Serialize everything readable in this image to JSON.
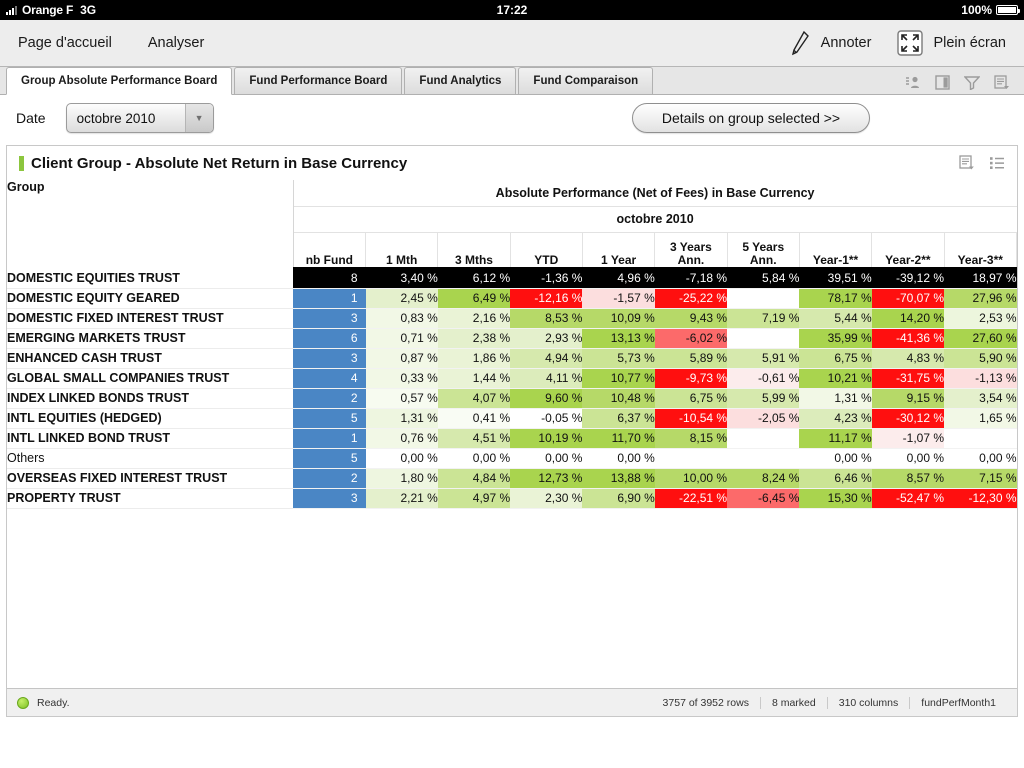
{
  "status_bar": {
    "carrier": "Orange F",
    "network": "3G",
    "time": "17:22",
    "battery_percent": "100%",
    "signal_icon": "signal-bars-icon",
    "battery_icon": "battery-icon"
  },
  "app_bar": {
    "nav_items": [
      {
        "label": "Page d'accueil",
        "name": "nav-item-home"
      },
      {
        "label": "Analyser",
        "name": "nav-item-analyse"
      }
    ],
    "annotate": {
      "label": "Annoter",
      "icon": "pencil-icon"
    },
    "fullscreen": {
      "label": "Plein écran",
      "icon": "fullscreen-icon"
    }
  },
  "tabs": {
    "items": [
      {
        "label": "Group Absolute Performance Board",
        "active": true
      },
      {
        "label": "Fund Performance Board",
        "active": false
      },
      {
        "label": "Fund Analytics",
        "active": false
      },
      {
        "label": "Fund Comparaison",
        "active": false
      }
    ],
    "icons": [
      "user-icon",
      "panel-icon",
      "filter-funnel-icon",
      "list-options-icon"
    ]
  },
  "filter_bar": {
    "date_label": "Date",
    "date_value": "octobre 2010",
    "date_caret_icon": "chevron-down-icon",
    "details_button": "Details on group selected >>"
  },
  "panel": {
    "title": "Client Group - Absolute Net Return in Base Currency",
    "accent_color": "#8cc63e",
    "icons": [
      "list-options-icon",
      "bullet-list-icon"
    ]
  },
  "table": {
    "group_header": "Group",
    "span_header": "Absolute Performance (Net of Fees) in Base Currency",
    "period_header": "octobre 2010",
    "columns": [
      "nb Fund",
      "1 Mth",
      "3 Mths",
      "YTD",
      "1 Year",
      "3 Years Ann.",
      "5 Years Ann.",
      "Year-1**",
      "Year-2**",
      "Year-3**"
    ],
    "rows": [
      {
        "label": "DOMESTIC EQUITIES TRUST",
        "bold": true,
        "selected": true,
        "cells": [
          {
            "v": "8",
            "bg": "#000000",
            "fg": "#ffffff"
          },
          {
            "v": "3,40 %",
            "bg": "#000000",
            "fg": "#ffffff"
          },
          {
            "v": "6,12 %",
            "bg": "#000000",
            "fg": "#ffffff"
          },
          {
            "v": "-1,36 %",
            "bg": "#000000",
            "fg": "#ffffff"
          },
          {
            "v": "4,96 %",
            "bg": "#000000",
            "fg": "#ffffff"
          },
          {
            "v": "-7,18 %",
            "bg": "#000000",
            "fg": "#ffffff"
          },
          {
            "v": "5,84 %",
            "bg": "#000000",
            "fg": "#ffffff"
          },
          {
            "v": "39,51 %",
            "bg": "#000000",
            "fg": "#ffffff"
          },
          {
            "v": "-39,12 %",
            "bg": "#000000",
            "fg": "#ffffff"
          },
          {
            "v": "18,97 %",
            "bg": "#000000",
            "fg": "#ffffff"
          }
        ]
      },
      {
        "label": "DOMESTIC EQUITY GEARED",
        "bold": true,
        "selected": false,
        "cells": [
          {
            "v": "1",
            "bg": "#4a86c5",
            "fg": "#ffffff"
          },
          {
            "v": "2,45 %",
            "bg": "#e4f0cc",
            "fg": "#111111"
          },
          {
            "v": "6,49 %",
            "bg": "#a9d44e",
            "fg": "#111111"
          },
          {
            "v": "-12,16 %",
            "bg": "#ff0f0f",
            "fg": "#ffffff"
          },
          {
            "v": "-1,57 %",
            "bg": "#fcdede",
            "fg": "#111111"
          },
          {
            "v": "-25,22 %",
            "bg": "#ff0f0f",
            "fg": "#ffffff"
          },
          {
            "v": "",
            "bg": "#ffffff",
            "fg": "#111111"
          },
          {
            "v": "78,17 %",
            "bg": "#a9d44e",
            "fg": "#111111"
          },
          {
            "v": "-70,07 %",
            "bg": "#ff0f0f",
            "fg": "#ffffff"
          },
          {
            "v": "27,96 %",
            "bg": "#b6d968",
            "fg": "#111111"
          }
        ]
      },
      {
        "label": "DOMESTIC FIXED INTEREST TRUST",
        "bold": true,
        "selected": false,
        "cells": [
          {
            "v": "3",
            "bg": "#4a86c5",
            "fg": "#ffffff"
          },
          {
            "v": "0,83 %",
            "bg": "#f2f8e6",
            "fg": "#111111"
          },
          {
            "v": "2,16 %",
            "bg": "#eaf3d6",
            "fg": "#111111"
          },
          {
            "v": "8,53 %",
            "bg": "#b6d968",
            "fg": "#111111"
          },
          {
            "v": "10,09 %",
            "bg": "#b6d968",
            "fg": "#111111"
          },
          {
            "v": "9,43 %",
            "bg": "#b6d968",
            "fg": "#111111"
          },
          {
            "v": "7,19 %",
            "bg": "#cbe495",
            "fg": "#111111"
          },
          {
            "v": "5,44 %",
            "bg": "#d6e9ad",
            "fg": "#111111"
          },
          {
            "v": "14,20 %",
            "bg": "#a9d44e",
            "fg": "#111111"
          },
          {
            "v": "2,53 %",
            "bg": "#edf6dd",
            "fg": "#111111"
          }
        ]
      },
      {
        "label": "EMERGING MARKETS TRUST",
        "bold": true,
        "selected": false,
        "cells": [
          {
            "v": "6",
            "bg": "#4a86c5",
            "fg": "#ffffff"
          },
          {
            "v": "0,71 %",
            "bg": "#f2f8e6",
            "fg": "#111111"
          },
          {
            "v": "2,38 %",
            "bg": "#e4f0cc",
            "fg": "#111111"
          },
          {
            "v": "2,93 %",
            "bg": "#e4f0cc",
            "fg": "#111111"
          },
          {
            "v": "13,13 %",
            "bg": "#a9d44e",
            "fg": "#111111"
          },
          {
            "v": "-6,02 %",
            "bg": "#fc6a6a",
            "fg": "#111111"
          },
          {
            "v": "",
            "bg": "#ffffff",
            "fg": "#111111"
          },
          {
            "v": "35,99 %",
            "bg": "#a9d44e",
            "fg": "#111111"
          },
          {
            "v": "-41,36 %",
            "bg": "#ff0f0f",
            "fg": "#ffffff"
          },
          {
            "v": "27,60 %",
            "bg": "#a9d44e",
            "fg": "#111111"
          }
        ]
      },
      {
        "label": "ENHANCED CASH TRUST",
        "bold": true,
        "selected": false,
        "cells": [
          {
            "v": "3",
            "bg": "#4a86c5",
            "fg": "#ffffff"
          },
          {
            "v": "0,87 %",
            "bg": "#f2f8e6",
            "fg": "#111111"
          },
          {
            "v": "1,86 %",
            "bg": "#eaf3d6",
            "fg": "#111111"
          },
          {
            "v": "4,94 %",
            "bg": "#d6e9ad",
            "fg": "#111111"
          },
          {
            "v": "5,73 %",
            "bg": "#cbe495",
            "fg": "#111111"
          },
          {
            "v": "5,89 %",
            "bg": "#cbe495",
            "fg": "#111111"
          },
          {
            "v": "5,91 %",
            "bg": "#d6e9ad",
            "fg": "#111111"
          },
          {
            "v": "6,75 %",
            "bg": "#cbe495",
            "fg": "#111111"
          },
          {
            "v": "4,83 %",
            "bg": "#d6e9ad",
            "fg": "#111111"
          },
          {
            "v": "5,90 %",
            "bg": "#cbe495",
            "fg": "#111111"
          }
        ]
      },
      {
        "label": "GLOBAL SMALL COMPANIES TRUST",
        "bold": true,
        "selected": false,
        "cells": [
          {
            "v": "4",
            "bg": "#4a86c5",
            "fg": "#ffffff"
          },
          {
            "v": "0,33 %",
            "bg": "#f2f8e6",
            "fg": "#111111"
          },
          {
            "v": "1,44 %",
            "bg": "#eaf3d6",
            "fg": "#111111"
          },
          {
            "v": "4,11 %",
            "bg": "#dcecbb",
            "fg": "#111111"
          },
          {
            "v": "10,77 %",
            "bg": "#a9d44e",
            "fg": "#111111"
          },
          {
            "v": "-9,73 %",
            "bg": "#ff0f0f",
            "fg": "#ffffff"
          },
          {
            "v": "-0,61 %",
            "bg": "#fcecec",
            "fg": "#111111"
          },
          {
            "v": "10,21 %",
            "bg": "#a9d44e",
            "fg": "#111111"
          },
          {
            "v": "-31,75 %",
            "bg": "#ff0f0f",
            "fg": "#ffffff"
          },
          {
            "v": "-1,13 %",
            "bg": "#fcdede",
            "fg": "#111111"
          }
        ]
      },
      {
        "label": "INDEX LINKED BONDS TRUST",
        "bold": true,
        "selected": false,
        "cells": [
          {
            "v": "2",
            "bg": "#4a86c5",
            "fg": "#ffffff"
          },
          {
            "v": "0,57 %",
            "bg": "#f7fbf0",
            "fg": "#111111"
          },
          {
            "v": "4,07 %",
            "bg": "#cbe495",
            "fg": "#111111"
          },
          {
            "v": "9,60 %",
            "bg": "#a9d44e",
            "fg": "#111111"
          },
          {
            "v": "10,48 %",
            "bg": "#b6d968",
            "fg": "#111111"
          },
          {
            "v": "6,75 %",
            "bg": "#cbe495",
            "fg": "#111111"
          },
          {
            "v": "5,99 %",
            "bg": "#d6e9ad",
            "fg": "#111111"
          },
          {
            "v": "1,31 %",
            "bg": "#f2f8e6",
            "fg": "#111111"
          },
          {
            "v": "9,15 %",
            "bg": "#b6d968",
            "fg": "#111111"
          },
          {
            "v": "3,54 %",
            "bg": "#e4f0cc",
            "fg": "#111111"
          }
        ]
      },
      {
        "label": "INTL EQUITIES (HEDGED)",
        "bold": true,
        "selected": false,
        "cells": [
          {
            "v": "5",
            "bg": "#4a86c5",
            "fg": "#ffffff"
          },
          {
            "v": "1,31 %",
            "bg": "#eef6e0",
            "fg": "#111111"
          },
          {
            "v": "0,41 %",
            "bg": "#f9fcf4",
            "fg": "#111111"
          },
          {
            "v": "-0,05 %",
            "bg": "#ffffff",
            "fg": "#111111"
          },
          {
            "v": "6,37 %",
            "bg": "#cbe495",
            "fg": "#111111"
          },
          {
            "v": "-10,54 %",
            "bg": "#ff0f0f",
            "fg": "#ffffff"
          },
          {
            "v": "-2,05 %",
            "bg": "#fcdede",
            "fg": "#111111"
          },
          {
            "v": "4,23 %",
            "bg": "#dcecbb",
            "fg": "#111111"
          },
          {
            "v": "-30,12 %",
            "bg": "#ff0f0f",
            "fg": "#ffffff"
          },
          {
            "v": "1,65 %",
            "bg": "#f2f8e6",
            "fg": "#111111"
          }
        ]
      },
      {
        "label": "INTL LINKED BOND TRUST",
        "bold": true,
        "selected": false,
        "cells": [
          {
            "v": "1",
            "bg": "#4a86c5",
            "fg": "#ffffff"
          },
          {
            "v": "0,76 %",
            "bg": "#f2f8e6",
            "fg": "#111111"
          },
          {
            "v": "4,51 %",
            "bg": "#d6e9ad",
            "fg": "#111111"
          },
          {
            "v": "10,19 %",
            "bg": "#a9d44e",
            "fg": "#111111"
          },
          {
            "v": "11,70 %",
            "bg": "#a9d44e",
            "fg": "#111111"
          },
          {
            "v": "8,15 %",
            "bg": "#b6d968",
            "fg": "#111111"
          },
          {
            "v": "",
            "bg": "#ffffff",
            "fg": "#111111"
          },
          {
            "v": "11,17 %",
            "bg": "#a9d44e",
            "fg": "#111111"
          },
          {
            "v": "-1,07 %",
            "bg": "#fcecec",
            "fg": "#111111"
          },
          {
            "v": "",
            "bg": "#ffffff",
            "fg": "#111111"
          }
        ]
      },
      {
        "label": "Others",
        "bold": false,
        "selected": false,
        "cells": [
          {
            "v": "5",
            "bg": "#4a86c5",
            "fg": "#ffffff"
          },
          {
            "v": "0,00 %",
            "bg": "#ffffff",
            "fg": "#111111"
          },
          {
            "v": "0,00 %",
            "bg": "#ffffff",
            "fg": "#111111"
          },
          {
            "v": "0,00 %",
            "bg": "#ffffff",
            "fg": "#111111"
          },
          {
            "v": "0,00 %",
            "bg": "#ffffff",
            "fg": "#111111"
          },
          {
            "v": "",
            "bg": "#ffffff",
            "fg": "#111111"
          },
          {
            "v": "",
            "bg": "#ffffff",
            "fg": "#111111"
          },
          {
            "v": "0,00 %",
            "bg": "#ffffff",
            "fg": "#111111"
          },
          {
            "v": "0,00 %",
            "bg": "#ffffff",
            "fg": "#111111"
          },
          {
            "v": "0,00 %",
            "bg": "#ffffff",
            "fg": "#111111"
          }
        ]
      },
      {
        "label": "OVERSEAS FIXED INTEREST TRUST",
        "bold": true,
        "selected": false,
        "cells": [
          {
            "v": "2",
            "bg": "#4a86c5",
            "fg": "#ffffff"
          },
          {
            "v": "1,80 %",
            "bg": "#eef6e0",
            "fg": "#111111"
          },
          {
            "v": "4,84 %",
            "bg": "#cbe495",
            "fg": "#111111"
          },
          {
            "v": "12,73 %",
            "bg": "#a9d44e",
            "fg": "#111111"
          },
          {
            "v": "13,88 %",
            "bg": "#a9d44e",
            "fg": "#111111"
          },
          {
            "v": "10,00 %",
            "bg": "#b6d968",
            "fg": "#111111"
          },
          {
            "v": "8,24 %",
            "bg": "#b6d968",
            "fg": "#111111"
          },
          {
            "v": "6,46 %",
            "bg": "#cbe495",
            "fg": "#111111"
          },
          {
            "v": "8,57 %",
            "bg": "#b6d968",
            "fg": "#111111"
          },
          {
            "v": "7,15 %",
            "bg": "#b6d968",
            "fg": "#111111"
          }
        ]
      },
      {
        "label": "PROPERTY TRUST",
        "bold": true,
        "selected": false,
        "cells": [
          {
            "v": "3",
            "bg": "#4a86c5",
            "fg": "#ffffff"
          },
          {
            "v": "2,21 %",
            "bg": "#e4f0cc",
            "fg": "#111111"
          },
          {
            "v": "4,97 %",
            "bg": "#cbe495",
            "fg": "#111111"
          },
          {
            "v": "2,30 %",
            "bg": "#eaf3d6",
            "fg": "#111111"
          },
          {
            "v": "6,90 %",
            "bg": "#cbe495",
            "fg": "#111111"
          },
          {
            "v": "-22,51 %",
            "bg": "#ff0f0f",
            "fg": "#ffffff"
          },
          {
            "v": "-6,45 %",
            "bg": "#fc6a6a",
            "fg": "#111111"
          },
          {
            "v": "15,30 %",
            "bg": "#a9d44e",
            "fg": "#111111"
          },
          {
            "v": "-52,47 %",
            "bg": "#ff0f0f",
            "fg": "#ffffff"
          },
          {
            "v": "-12,30 %",
            "bg": "#ff0f0f",
            "fg": "#ffffff"
          }
        ]
      }
    ]
  },
  "bottom_bar": {
    "status_icon": "green-led-icon",
    "status_text": "Ready.",
    "rows_text": "3757 of 3952 rows",
    "marked_text": "8 marked",
    "columns_text": "310 columns",
    "source_text": "fundPerfMonth1"
  }
}
